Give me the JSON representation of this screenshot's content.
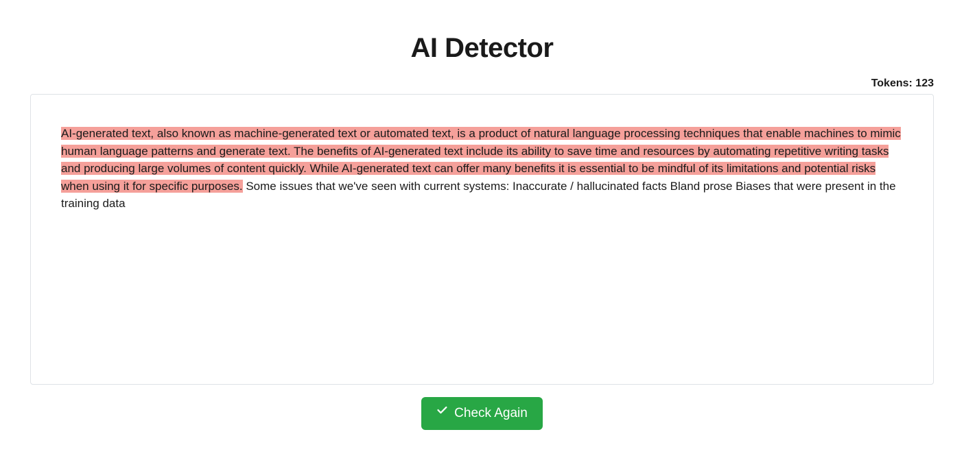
{
  "title": "AI Detector",
  "tokens": {
    "label": "Tokens:",
    "value": "123"
  },
  "content": {
    "highlighted": "AI-generated text, also known as machine-generated text or automated text, is a product of natural language processing techniques that enable machines to mimic human language patterns and generate text. The benefits of AI-generated text include its ability to save time and resources by automating repetitive writing tasks and producing large volumes of content quickly. While AI-generated text can offer many benefits it is essential to be mindful of its limitations and potential risks when using it for specific purposes.",
    "plain": " Some issues that we've seen with current systems: Inaccurate / hallucinated facts Bland prose Biases that were present in the training data"
  },
  "button": {
    "label": "Check Again"
  }
}
